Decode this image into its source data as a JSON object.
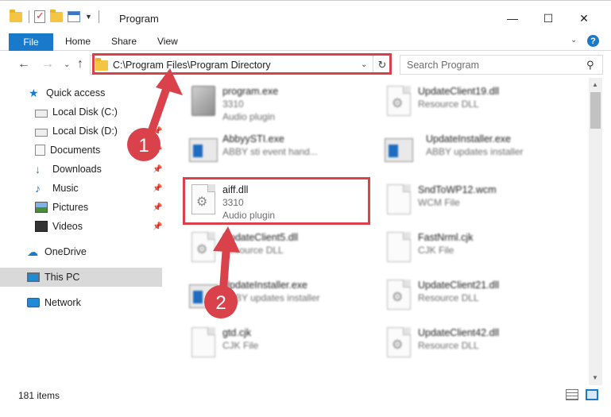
{
  "window": {
    "title": "Program",
    "minimize_icon": "minimize-icon",
    "maximize_icon": "maximize-icon",
    "close_icon": "close-icon"
  },
  "ribbon": {
    "tabs": [
      {
        "label": "File"
      },
      {
        "label": "Home"
      },
      {
        "label": "Share"
      },
      {
        "label": "View"
      }
    ],
    "help_label": "?"
  },
  "nav": {
    "address": "C:\\Program Files\\Program Directory",
    "search_placeholder": "Search Program"
  },
  "sidebar": {
    "items": [
      {
        "label": "Quick access"
      },
      {
        "label": "Local Disk (C:)"
      },
      {
        "label": "Local Disk (D:)"
      },
      {
        "label": "Documents"
      },
      {
        "label": "Downloads"
      },
      {
        "label": "Music"
      },
      {
        "label": "Pictures"
      },
      {
        "label": "Videos"
      },
      {
        "label": "OneDrive"
      },
      {
        "label": "This PC"
      },
      {
        "label": "Network"
      }
    ]
  },
  "files": [
    {
      "name": "program.exe",
      "line2": "3310",
      "line3": "Audio plugin"
    },
    {
      "name": "UpdateClient19.dll",
      "line2": "Resource DLL",
      "line3": ""
    },
    {
      "name": "AbbyySTI.exe",
      "line2": "ABBY sti event hand...",
      "line3": ""
    },
    {
      "name": "UpdateInstaller.exe",
      "line2": "ABBY updates installer",
      "line3": ""
    },
    {
      "name": "aiff.dll",
      "line2": "3310",
      "line3": "Audio plugin"
    },
    {
      "name": "SndToWP12.wcm",
      "line2": "WCM File",
      "line3": ""
    },
    {
      "name": "UpdateClient5.dll",
      "line2": "Resource DLL",
      "line3": ""
    },
    {
      "name": "FastNrml.cjk",
      "line2": "CJK File",
      "line3": ""
    },
    {
      "name": "UpdateInstaller.exe",
      "line2": "ABBY updates installer",
      "line3": ""
    },
    {
      "name": "UpdateClient21.dll",
      "line2": "Resource DLL",
      "line3": ""
    },
    {
      "name": "gtd.cjk",
      "line2": "CJK File",
      "line3": ""
    },
    {
      "name": "UpdateClient42.dll",
      "line2": "Resource DLL",
      "line3": ""
    }
  ],
  "status": {
    "item_count": "181 items"
  },
  "annotations": {
    "badge1": "1",
    "badge2": "2",
    "accent_color": "#d9424b"
  },
  "colors": {
    "accent_blue": "#1979ca",
    "selected_bg": "#d9d9d9"
  }
}
